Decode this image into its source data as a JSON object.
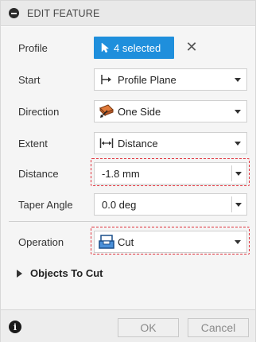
{
  "header": {
    "title": "EDIT FEATURE"
  },
  "rows": {
    "profile": {
      "label": "Profile",
      "selection_text": "4 selected"
    },
    "start": {
      "label": "Start",
      "value": "Profile Plane",
      "icon": "profile-plane-icon"
    },
    "direction": {
      "label": "Direction",
      "value": "One Side",
      "icon": "one-side-icon"
    },
    "extent": {
      "label": "Extent",
      "value": "Distance",
      "icon": "distance-icon"
    },
    "distance": {
      "label": "Distance",
      "value": "-1.8 mm"
    },
    "taper_angle": {
      "label": "Taper Angle",
      "value": "0.0 deg"
    },
    "operation": {
      "label": "Operation",
      "value": "Cut",
      "icon": "cut-icon"
    }
  },
  "objects_to_cut": {
    "label": "Objects To Cut"
  },
  "footer": {
    "ok_label": "OK",
    "cancel_label": "Cancel"
  },
  "colors": {
    "selection_blue": "#1f8fdc",
    "highlight_red": "#e0303a",
    "panel_bg": "#f5f5f5"
  }
}
